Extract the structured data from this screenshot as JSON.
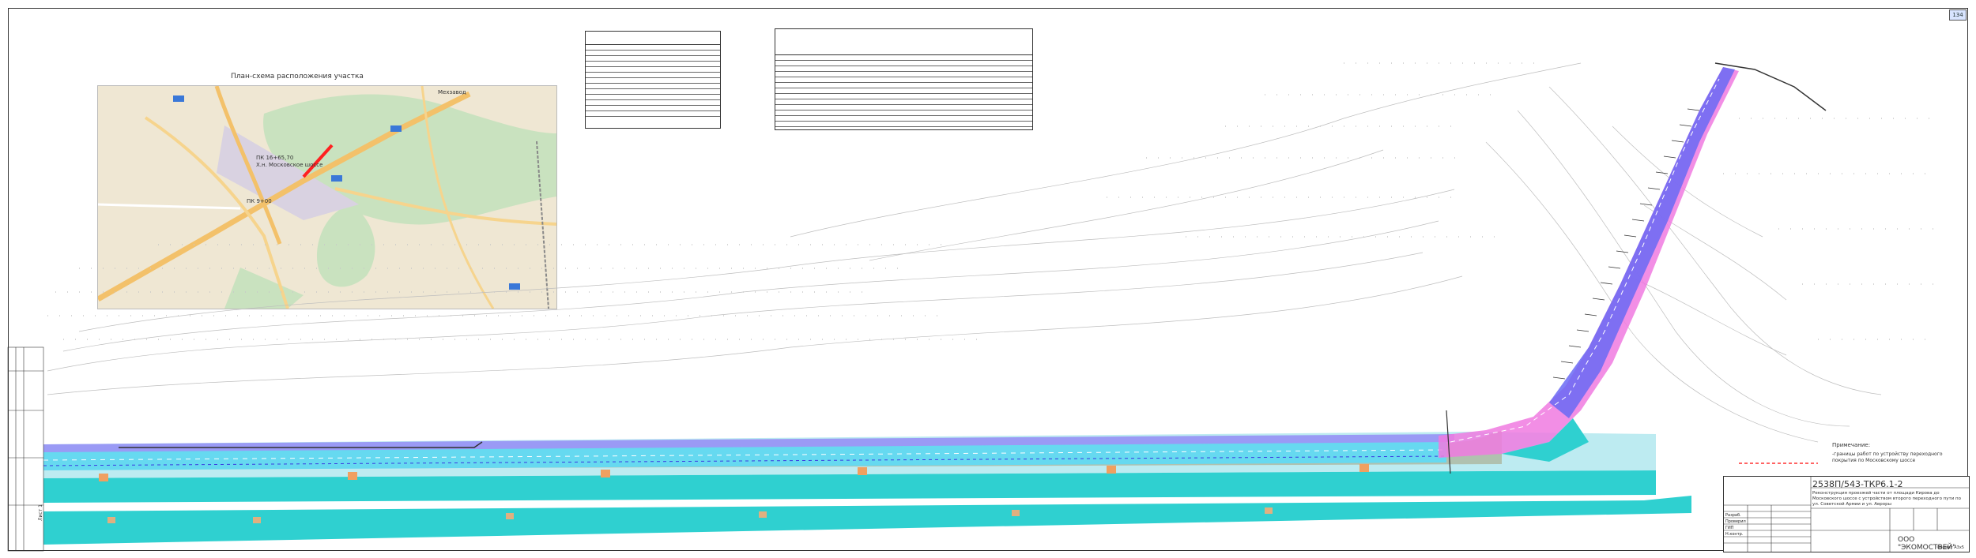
{
  "sheet": {
    "page_number": "134"
  },
  "location_plan": {
    "title": "План-схема расположения участка",
    "labels": {
      "pk_end": "ПК 16+65,70",
      "pk_end_sub": "Х.н. Московское шоссе",
      "pk_start": "ПК 9+00",
      "town": "Мехзавод"
    }
  },
  "notes": {
    "title": "Примечание:",
    "body": "-границы работ по устройству переходного покрытия по Московскому шоссе"
  },
  "title_block": {
    "code": "2538П/543-ТКР6.1-2",
    "description": "Реконструкция проезжей части от площади Кирова до Московского шоссе с устройством второго переходного пути по ул. Советской Армии и ул. Авроры",
    "roles": [
      "Разраб.",
      "Проверил",
      "ГИП",
      "Н.контр."
    ],
    "company": "ООО \"ЭКОМОСТВЕЙ\"",
    "format": "Формат А3х5"
  },
  "left_strip": {
    "sheet_label": "Лист 1"
  },
  "colors": {
    "road_blue": "#5a5af0",
    "road_magenta": "#f060e0",
    "cyan": "#32d2d2",
    "tan": "#e0b080",
    "red_line": "#ff3030"
  }
}
